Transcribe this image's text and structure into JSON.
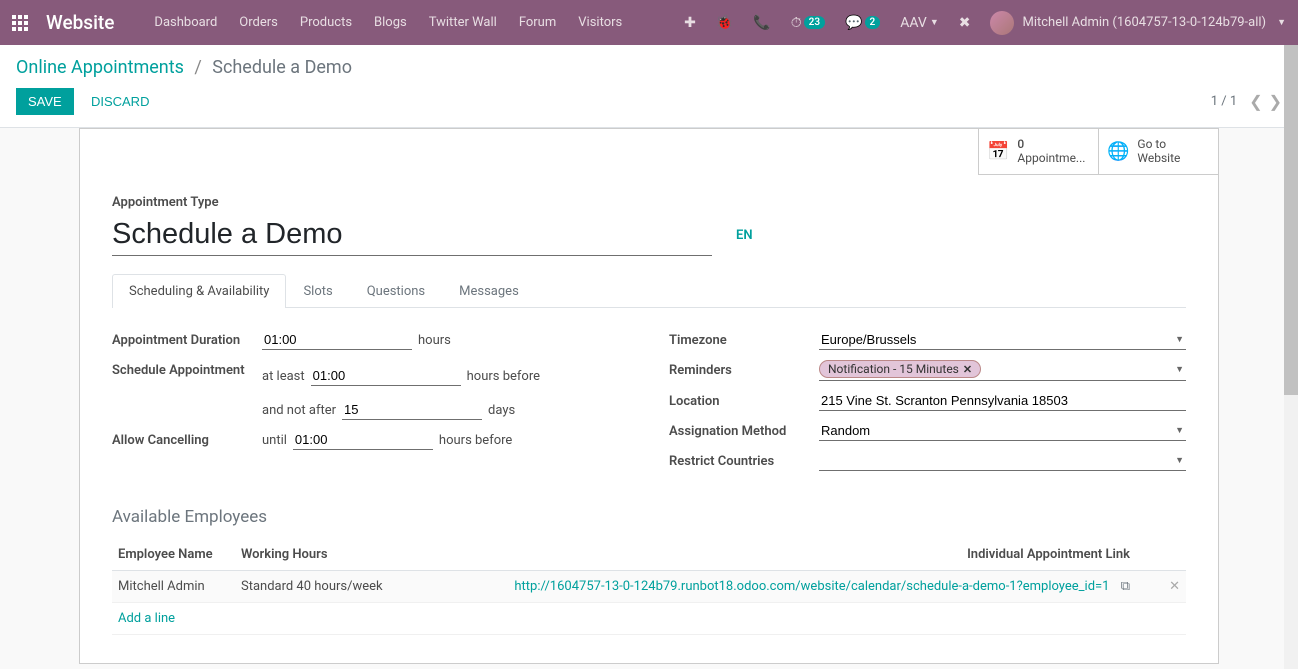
{
  "topbar": {
    "brand": "Website",
    "nav": [
      "Dashboard",
      "Orders",
      "Products",
      "Blogs",
      "Twitter Wall",
      "Forum",
      "Visitors"
    ],
    "badge_clock": "23",
    "badge_chat": "2",
    "aav": "AAV",
    "user": "Mitchell Admin (1604757-13-0-124b79-all)"
  },
  "crumb": {
    "parent": "Online Appointments",
    "current": "Schedule a Demo"
  },
  "actions": {
    "save": "Save",
    "discard": "Discard",
    "pager": "1 / 1"
  },
  "stats": {
    "appointments_count": "0",
    "appointments_label": "Appointme...",
    "goto_label": "Go to Website"
  },
  "form": {
    "type_label": "Appointment Type",
    "title": "Schedule a Demo",
    "lang": "EN",
    "tabs": [
      "Scheduling & Availability",
      "Slots",
      "Questions",
      "Messages"
    ],
    "labels": {
      "duration": "Appointment Duration",
      "schedule": "Schedule Appointment",
      "cancel": "Allow Cancelling",
      "timezone": "Timezone",
      "reminders": "Reminders",
      "location": "Location",
      "assign": "Assignation Method",
      "restrict": "Restrict Countries"
    },
    "values": {
      "duration": "01:00",
      "duration_unit": "hours",
      "at_least_prefix": "at least",
      "at_least": "01:00",
      "at_least_unit": "hours before",
      "not_after_prefix": "and not after",
      "not_after": "15",
      "not_after_unit": "days",
      "until_prefix": "until",
      "until": "01:00",
      "until_unit": "hours before",
      "timezone": "Europe/Brussels",
      "reminder_tag": "Notification - 15 Minutes",
      "location": "215 Vine St. Scranton Pennsylvania 18503",
      "assign": "Random"
    }
  },
  "employees": {
    "title": "Available Employees",
    "headers": {
      "name": "Employee Name",
      "hours": "Working Hours",
      "link": "Individual Appointment Link"
    },
    "rows": [
      {
        "name": "Mitchell Admin",
        "hours": "Standard 40 hours/week",
        "link": "http://1604757-13-0-124b79.runbot18.odoo.com/website/calendar/schedule-a-demo-1?employee_id=1"
      }
    ],
    "add": "Add a line"
  }
}
